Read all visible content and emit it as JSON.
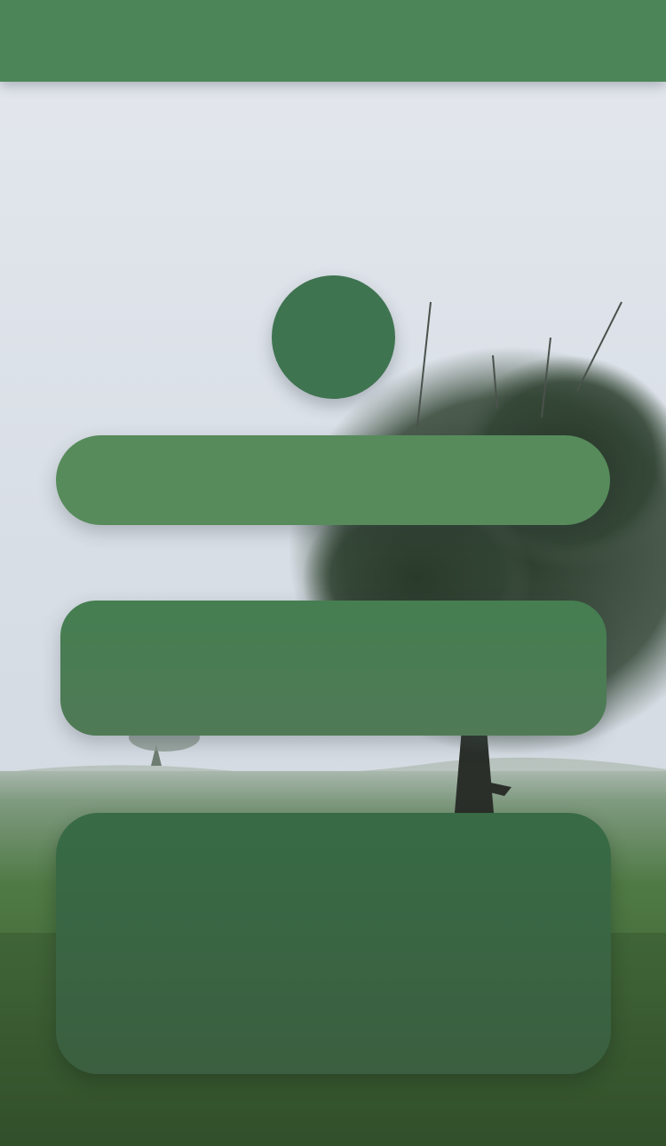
{
  "app": {
    "top_bar_title": ""
  },
  "profile": {
    "avatar_alt": ""
  },
  "primary_pill": {
    "label": ""
  },
  "medium_card": {
    "label": ""
  },
  "large_card": {
    "label": ""
  },
  "theme": {
    "accent": "#4c8658",
    "avatar": "#3f7450",
    "pill": "#578b5b",
    "card_medium": "#4a7d53",
    "card_large": "#3a6643",
    "sky": "#dde3ea",
    "grass": "#3f6a35"
  },
  "background": {
    "scene": "foggy-meadow-with-tree"
  }
}
